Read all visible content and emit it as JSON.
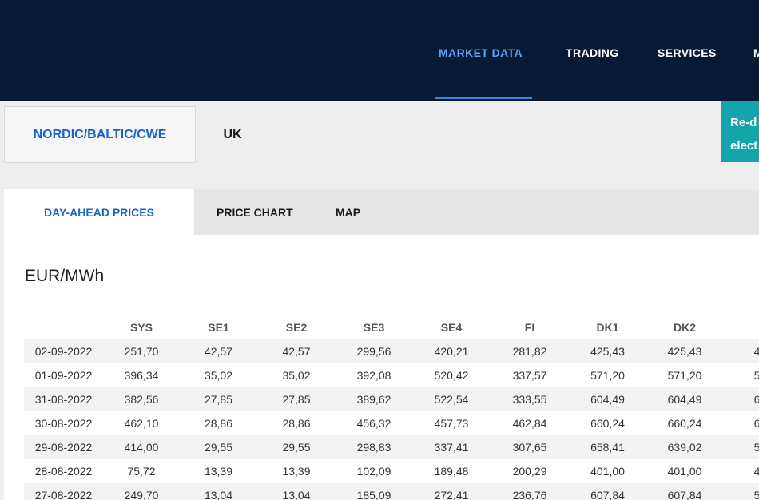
{
  "header": {
    "nav": [
      {
        "label": "MARKET DATA",
        "active": true
      },
      {
        "label": "TRADING",
        "active": false
      },
      {
        "label": "SERVICES",
        "active": false
      },
      {
        "label": "M",
        "active": false
      }
    ]
  },
  "regions": {
    "tabs": [
      {
        "label": "NORDIC/BALTIC/CWE",
        "active": true
      },
      {
        "label": "UK",
        "active": false
      }
    ],
    "banner_line1": "Re-d",
    "banner_line2": "elect"
  },
  "subtabs": [
    {
      "label": "DAY-AHEAD PRICES",
      "active": true
    },
    {
      "label": "PRICE CHART",
      "active": false
    },
    {
      "label": "MAP",
      "active": false
    }
  ],
  "unit": "EUR/MWh",
  "table": {
    "columns": [
      "",
      "SYS",
      "SE1",
      "SE2",
      "SE3",
      "SE4",
      "FI",
      "DK1",
      "DK2",
      ""
    ],
    "rows": [
      [
        "02-09-2022",
        "251,70",
        "42,57",
        "42,57",
        "299,56",
        "420,21",
        "281,82",
        "425,43",
        "425,43",
        "4"
      ],
      [
        "01-09-2022",
        "396,34",
        "35,02",
        "35,02",
        "392,08",
        "520,42",
        "337,57",
        "571,20",
        "571,20",
        "5"
      ],
      [
        "31-08-2022",
        "382,56",
        "27,85",
        "27,85",
        "389,62",
        "522,54",
        "333,55",
        "604,49",
        "604,49",
        "6"
      ],
      [
        "30-08-2022",
        "462,10",
        "28,86",
        "28,86",
        "456,32",
        "457,73",
        "462,84",
        "660,24",
        "660,24",
        "6"
      ],
      [
        "29-08-2022",
        "414,00",
        "29,55",
        "29,55",
        "298,83",
        "337,41",
        "307,65",
        "658,41",
        "639,02",
        "5"
      ],
      [
        "28-08-2022",
        "75,72",
        "13,39",
        "13,39",
        "102,09",
        "189,48",
        "200,29",
        "401,00",
        "401,00",
        "4"
      ],
      [
        "27-08-2022",
        "249,70",
        "13,04",
        "13,04",
        "185,09",
        "272,41",
        "236,76",
        "607,84",
        "607,84",
        "5"
      ]
    ]
  }
}
